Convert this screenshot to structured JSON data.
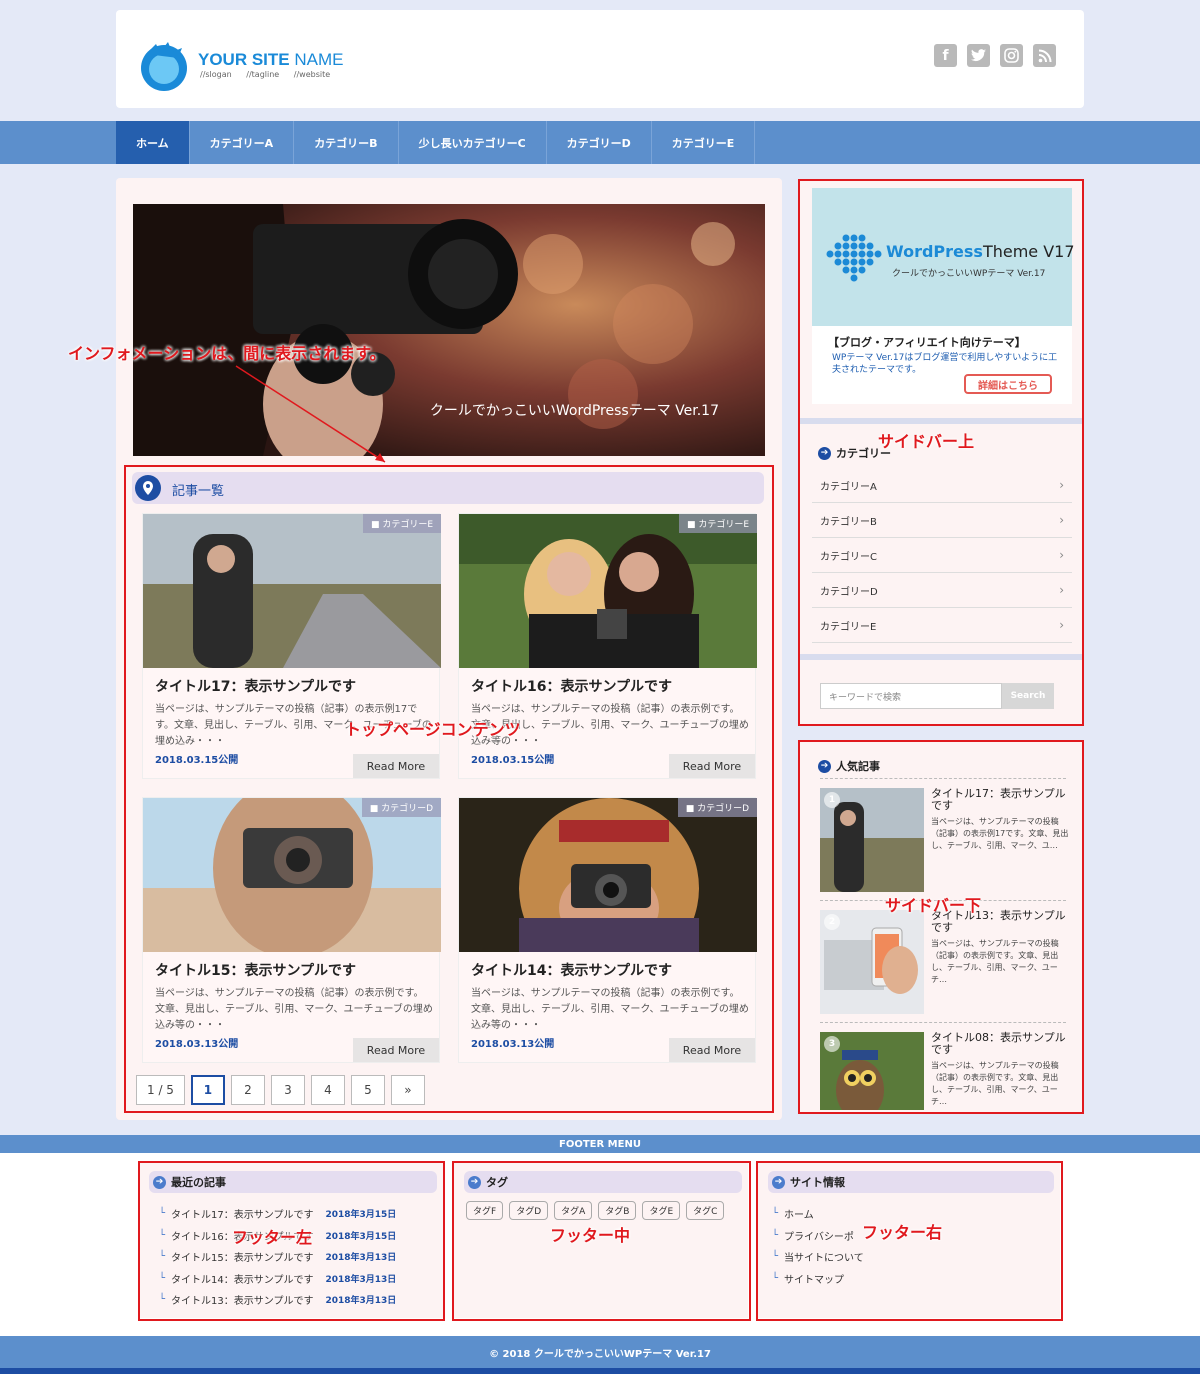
{
  "header": {
    "site_name_a": "YOUR SITE",
    "site_name_b": "NAME",
    "slogan": "//slogan",
    "tagline": "//tagline",
    "website": "//website",
    "social": [
      "f",
      "t",
      "ig",
      "rss"
    ]
  },
  "nav": [
    "ホーム",
    "カテゴリーA",
    "カテゴリーB",
    "少し長いカテゴリーC",
    "カテゴリーD",
    "カテゴリーE"
  ],
  "hero": {
    "caption": "クールでかっこいいWordPressテーマ Ver.17"
  },
  "annotations": {
    "info": "インフォメーションは、間に表示されます。",
    "top_content": "トップページコンテンツ",
    "sidebar_top": "サイドバー上",
    "sidebar_bottom": "サイドバー下",
    "footer_left": "フッター左",
    "footer_center": "フッター中",
    "footer_right": "フッター右"
  },
  "section": {
    "title": "記事一覧"
  },
  "cards": [
    {
      "category": "カテゴリーE",
      "title": "タイトル17：表示サンプルです",
      "text": "当ページは、サンプルテーマの投稿（記事）の表示例17です。文章、見出し、テーブル、引用、マーク、ユーチューブの埋め込み・・・",
      "date": "2018.03.15公開",
      "more": "Read More"
    },
    {
      "category": "カテゴリーE",
      "title": "タイトル16：表示サンプルです",
      "text": "当ページは、サンプルテーマの投稿（記事）の表示例です。文章、見出し、テーブル、引用、マーク、ユーチューブの埋め込み等の・・・",
      "date": "2018.03.15公開",
      "more": "Read More"
    },
    {
      "category": "カテゴリーD",
      "title": "タイトル15：表示サンプルです",
      "text": "当ページは、サンプルテーマの投稿（記事）の表示例です。文章、見出し、テーブル、引用、マーク、ユーチューブの埋め込み等の・・・",
      "date": "2018.03.13公開",
      "more": "Read More"
    },
    {
      "category": "カテゴリーD",
      "title": "タイトル14：表示サンプルです",
      "text": "当ページは、サンプルテーマの投稿（記事）の表示例です。文章、見出し、テーブル、引用、マーク、ユーチューブの埋め込み等の・・・",
      "date": "2018.03.13公開",
      "more": "Read More"
    }
  ],
  "pager": [
    "1 / 5",
    "1",
    "2",
    "3",
    "4",
    "5",
    "»"
  ],
  "sidebar": {
    "banner_brand_a": "WordPress",
    "banner_brand_b": "Theme V17",
    "banner_sub": "クールでかっこいいWPテーマ Ver.17",
    "banner_heading": "【ブログ・アフィリエイト向けテーマ】",
    "banner_text": "WPテーマ Ver.17はブログ運営で利用しやすいように工夫されたテーマです。",
    "banner_button": "詳細はこちら",
    "category_heading": "カテゴリー",
    "categories": [
      "カテゴリーA",
      "カテゴリーB",
      "カテゴリーC",
      "カテゴリーD",
      "カテゴリーE"
    ],
    "search_placeholder": "キーワードで検索",
    "search_button": "Search",
    "popular_heading": "人気記事",
    "popular": [
      {
        "rank": "1",
        "title": "タイトル17：表示サンプルです",
        "text": "当ページは、サンプルテーマの投稿（記事）の表示例17です。文章、見出し、テーブル、引用、マーク、ユ…"
      },
      {
        "rank": "2",
        "title": "タイトル13：表示サンプルです",
        "text": "当ページは、サンプルテーマの投稿（記事）の表示例です。文章、見出し、テーブル、引用、マーク、ユーチ…"
      },
      {
        "rank": "3",
        "title": "タイトル08：表示サンプルです",
        "text": "当ページは、サンプルテーマの投稿（記事）の表示例です。文章、見出し、テーブル、引用、マーク、ユーチ…"
      }
    ]
  },
  "footer": {
    "menu_label": "FOOTER MENU",
    "recent_heading": "最近の記事",
    "recent": [
      {
        "title": "タイトル17：表示サンプルです",
        "date": "2018年3月15日"
      },
      {
        "title": "タイトル16：表示サンプルです",
        "date": "2018年3月15日"
      },
      {
        "title": "タイトル15：表示サンプルです",
        "date": "2018年3月13日"
      },
      {
        "title": "タイトル14：表示サンプルです",
        "date": "2018年3月13日"
      },
      {
        "title": "タイトル13：表示サンプルです",
        "date": "2018年3月13日"
      }
    ],
    "tag_heading": "タグ",
    "tags": [
      "タグF",
      "タグD",
      "タグA",
      "タグB",
      "タグE",
      "タグC"
    ],
    "info_heading": "サイト情報",
    "info_links": [
      "ホーム",
      "プライバシーポ",
      "当サイトについて",
      "サイトマップ"
    ],
    "copyright": "© 2018 クールでかっこいいWPテーマ Ver.17"
  }
}
